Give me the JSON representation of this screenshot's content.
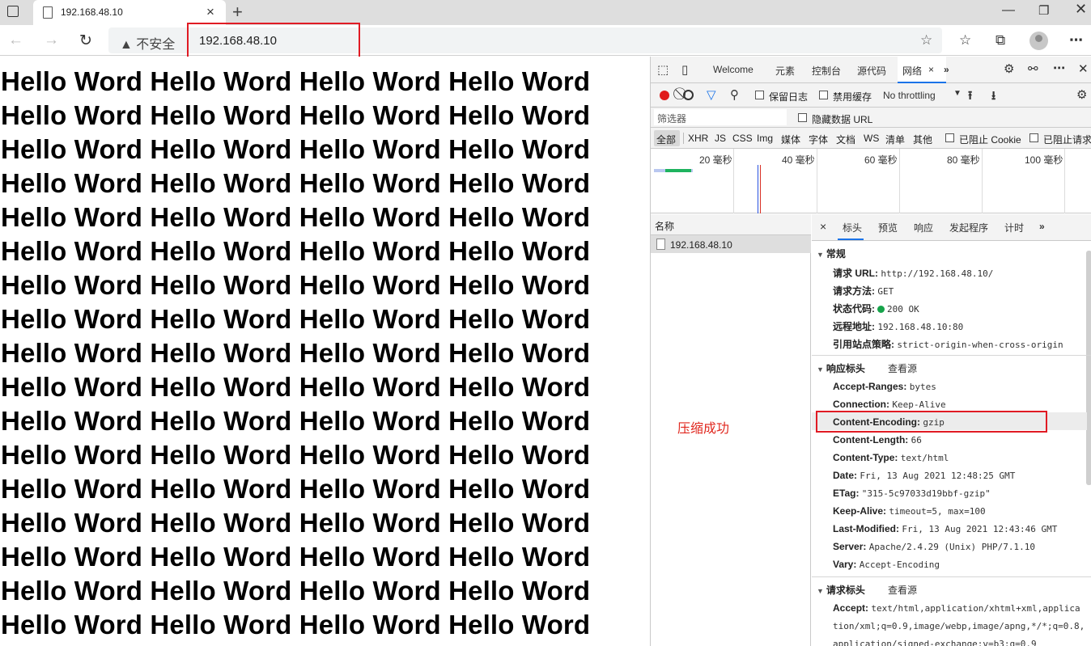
{
  "browser": {
    "tab_title": "192.168.48.10",
    "security_label": "不安全",
    "url": "192.168.48.10"
  },
  "page": {
    "line_text": "Hello Word Hello Word Hello Word Hello Word",
    "line_count": 17
  },
  "devtools": {
    "tabs": [
      "Welcome",
      "元素",
      "控制台",
      "源代码",
      "网络"
    ],
    "active_tab": "网络",
    "toolbar": {
      "preserve_log": "保留日志",
      "disable_cache": "禁用缓存",
      "throttling": "No throttling"
    },
    "filter_placeholder": "筛选器",
    "hide_data_urls": "隐藏数据 URL",
    "type_filters": [
      "全部",
      "XHR",
      "JS",
      "CSS",
      "Img",
      "媒体",
      "字体",
      "文档",
      "WS",
      "清单",
      "其他"
    ],
    "blocked_cookies": "已阻止 Cookie",
    "blocked_requests": "已阻止请求",
    "timeline_labels": [
      "20 毫秒",
      "40 毫秒",
      "60 毫秒",
      "80 毫秒",
      "100 毫秒"
    ],
    "name_header": "名称",
    "request_name": "192.168.48.10",
    "detail_tabs": [
      "标头",
      "预览",
      "响应",
      "发起程序",
      "计时"
    ],
    "general": {
      "title": "常规",
      "rows": [
        {
          "k": "请求 URL:",
          "v": "http://192.168.48.10/"
        },
        {
          "k": "请求方法:",
          "v": "GET"
        },
        {
          "k": "状态代码:",
          "v": "200 OK"
        },
        {
          "k": "远程地址:",
          "v": "192.168.48.10:80"
        },
        {
          "k": "引用站点策略:",
          "v": "strict-origin-when-cross-origin"
        }
      ]
    },
    "response_headers": {
      "title": "响应标头",
      "view_source": "查看源",
      "rows": [
        {
          "k": "Accept-Ranges:",
          "v": "bytes"
        },
        {
          "k": "Connection:",
          "v": "Keep-Alive"
        },
        {
          "k": "Content-Encoding:",
          "v": "gzip"
        },
        {
          "k": "Content-Length:",
          "v": "66"
        },
        {
          "k": "Content-Type:",
          "v": "text/html"
        },
        {
          "k": "Date:",
          "v": "Fri, 13 Aug 2021 12:48:25 GMT"
        },
        {
          "k": "ETag:",
          "v": "\"315-5c97033d19bbf-gzip\""
        },
        {
          "k": "Keep-Alive:",
          "v": "timeout=5, max=100"
        },
        {
          "k": "Last-Modified:",
          "v": "Fri, 13 Aug 2021 12:43:46 GMT"
        },
        {
          "k": "Server:",
          "v": "Apache/2.4.29 (Unix) PHP/7.1.10"
        },
        {
          "k": "Vary:",
          "v": "Accept-Encoding"
        }
      ]
    },
    "request_headers": {
      "title": "请求标头",
      "view_source": "查看源",
      "accept_key": "Accept:",
      "accept_lines": [
        "text/html,application/xhtml+xml,applica",
        "tion/xml;q=0.9,image/webp,image/apng,*/*;q=0.8,",
        "application/signed-exchange;v=b3;q=0.9"
      ]
    }
  },
  "annotation": "压缩成功",
  "colors": {
    "accent": "#1a73e8",
    "highlight_red": "#e01b24",
    "status_green": "#16a34a"
  }
}
